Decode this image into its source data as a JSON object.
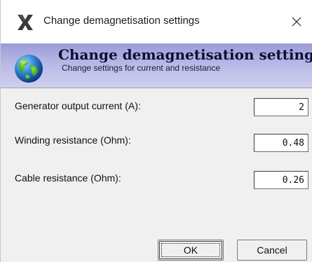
{
  "window": {
    "title": "Change demagnetisation settings",
    "app_icon": "x-logo-icon",
    "close_icon": "close-icon"
  },
  "header": {
    "title": "Change demagnetisation settings",
    "subtitle": "Change settings for current and resistance",
    "icon": "globe-icon"
  },
  "fields": [
    {
      "label": "Generator output current (A):",
      "value": "2"
    },
    {
      "label": "Winding resistance (Ohm):",
      "value": "0.48"
    },
    {
      "label": "Cable resistance (Ohm):",
      "value": "0.26"
    }
  ],
  "buttons": {
    "ok_label": "OK",
    "cancel_label": "Cancel"
  },
  "colors": {
    "banner_top": "#9b9bd8",
    "banner_bottom": "#cfcff0",
    "window_bg": "#f0f0f0"
  }
}
